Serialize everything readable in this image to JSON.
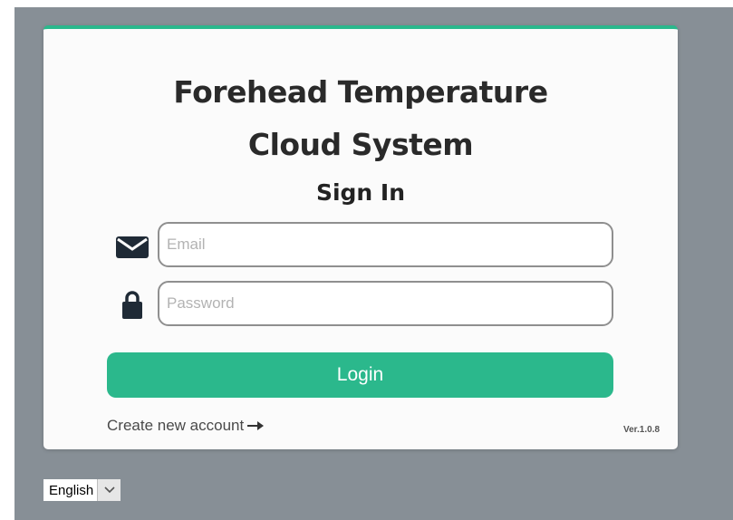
{
  "app": {
    "title_line1": "Forehead Temperature",
    "title_line2": "Cloud System",
    "subtitle": "Sign In"
  },
  "form": {
    "email": {
      "placeholder": "Email",
      "value": "",
      "icon": "envelope-icon"
    },
    "password": {
      "placeholder": "Password",
      "value": "",
      "icon": "lock-icon"
    },
    "login_label": "Login",
    "create_account_label": "Create new account",
    "create_account_icon": "arrow-right-icon"
  },
  "footer": {
    "version": "Ver.1.0.8"
  },
  "language": {
    "selected": "English",
    "icon": "chevron-down-icon"
  },
  "colors": {
    "accent": "#2bb88c",
    "page_background": "#878f96",
    "card_background": "#fbfbfb",
    "title_text": "#2a2a2a"
  }
}
